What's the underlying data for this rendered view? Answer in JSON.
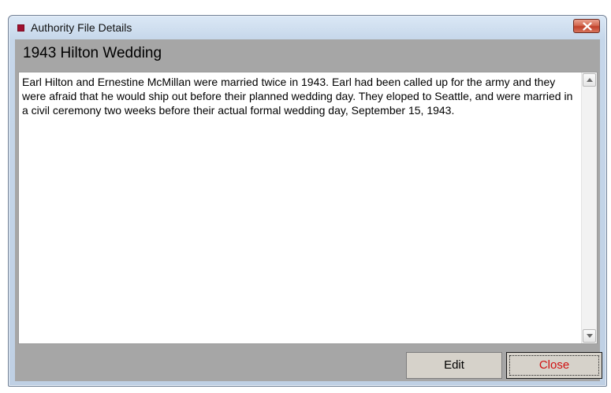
{
  "window": {
    "title": "Authority File Details",
    "accent_color": "#a01030",
    "close_icon": "close-x-icon"
  },
  "record": {
    "heading": "1943 Hilton Wedding",
    "text": "Earl Hilton and Ernestine McMillan were married twice in 1943.  Earl had been called up for the army and they were afraid that he would ship out before their planned wedding day.  They eloped to Seattle, and were married in a civil ceremony two weeks before their actual formal wedding day, September 15, 1943."
  },
  "buttons": {
    "edit_label": "Edit",
    "close_label": "Close",
    "close_label_color": "#d01010"
  }
}
